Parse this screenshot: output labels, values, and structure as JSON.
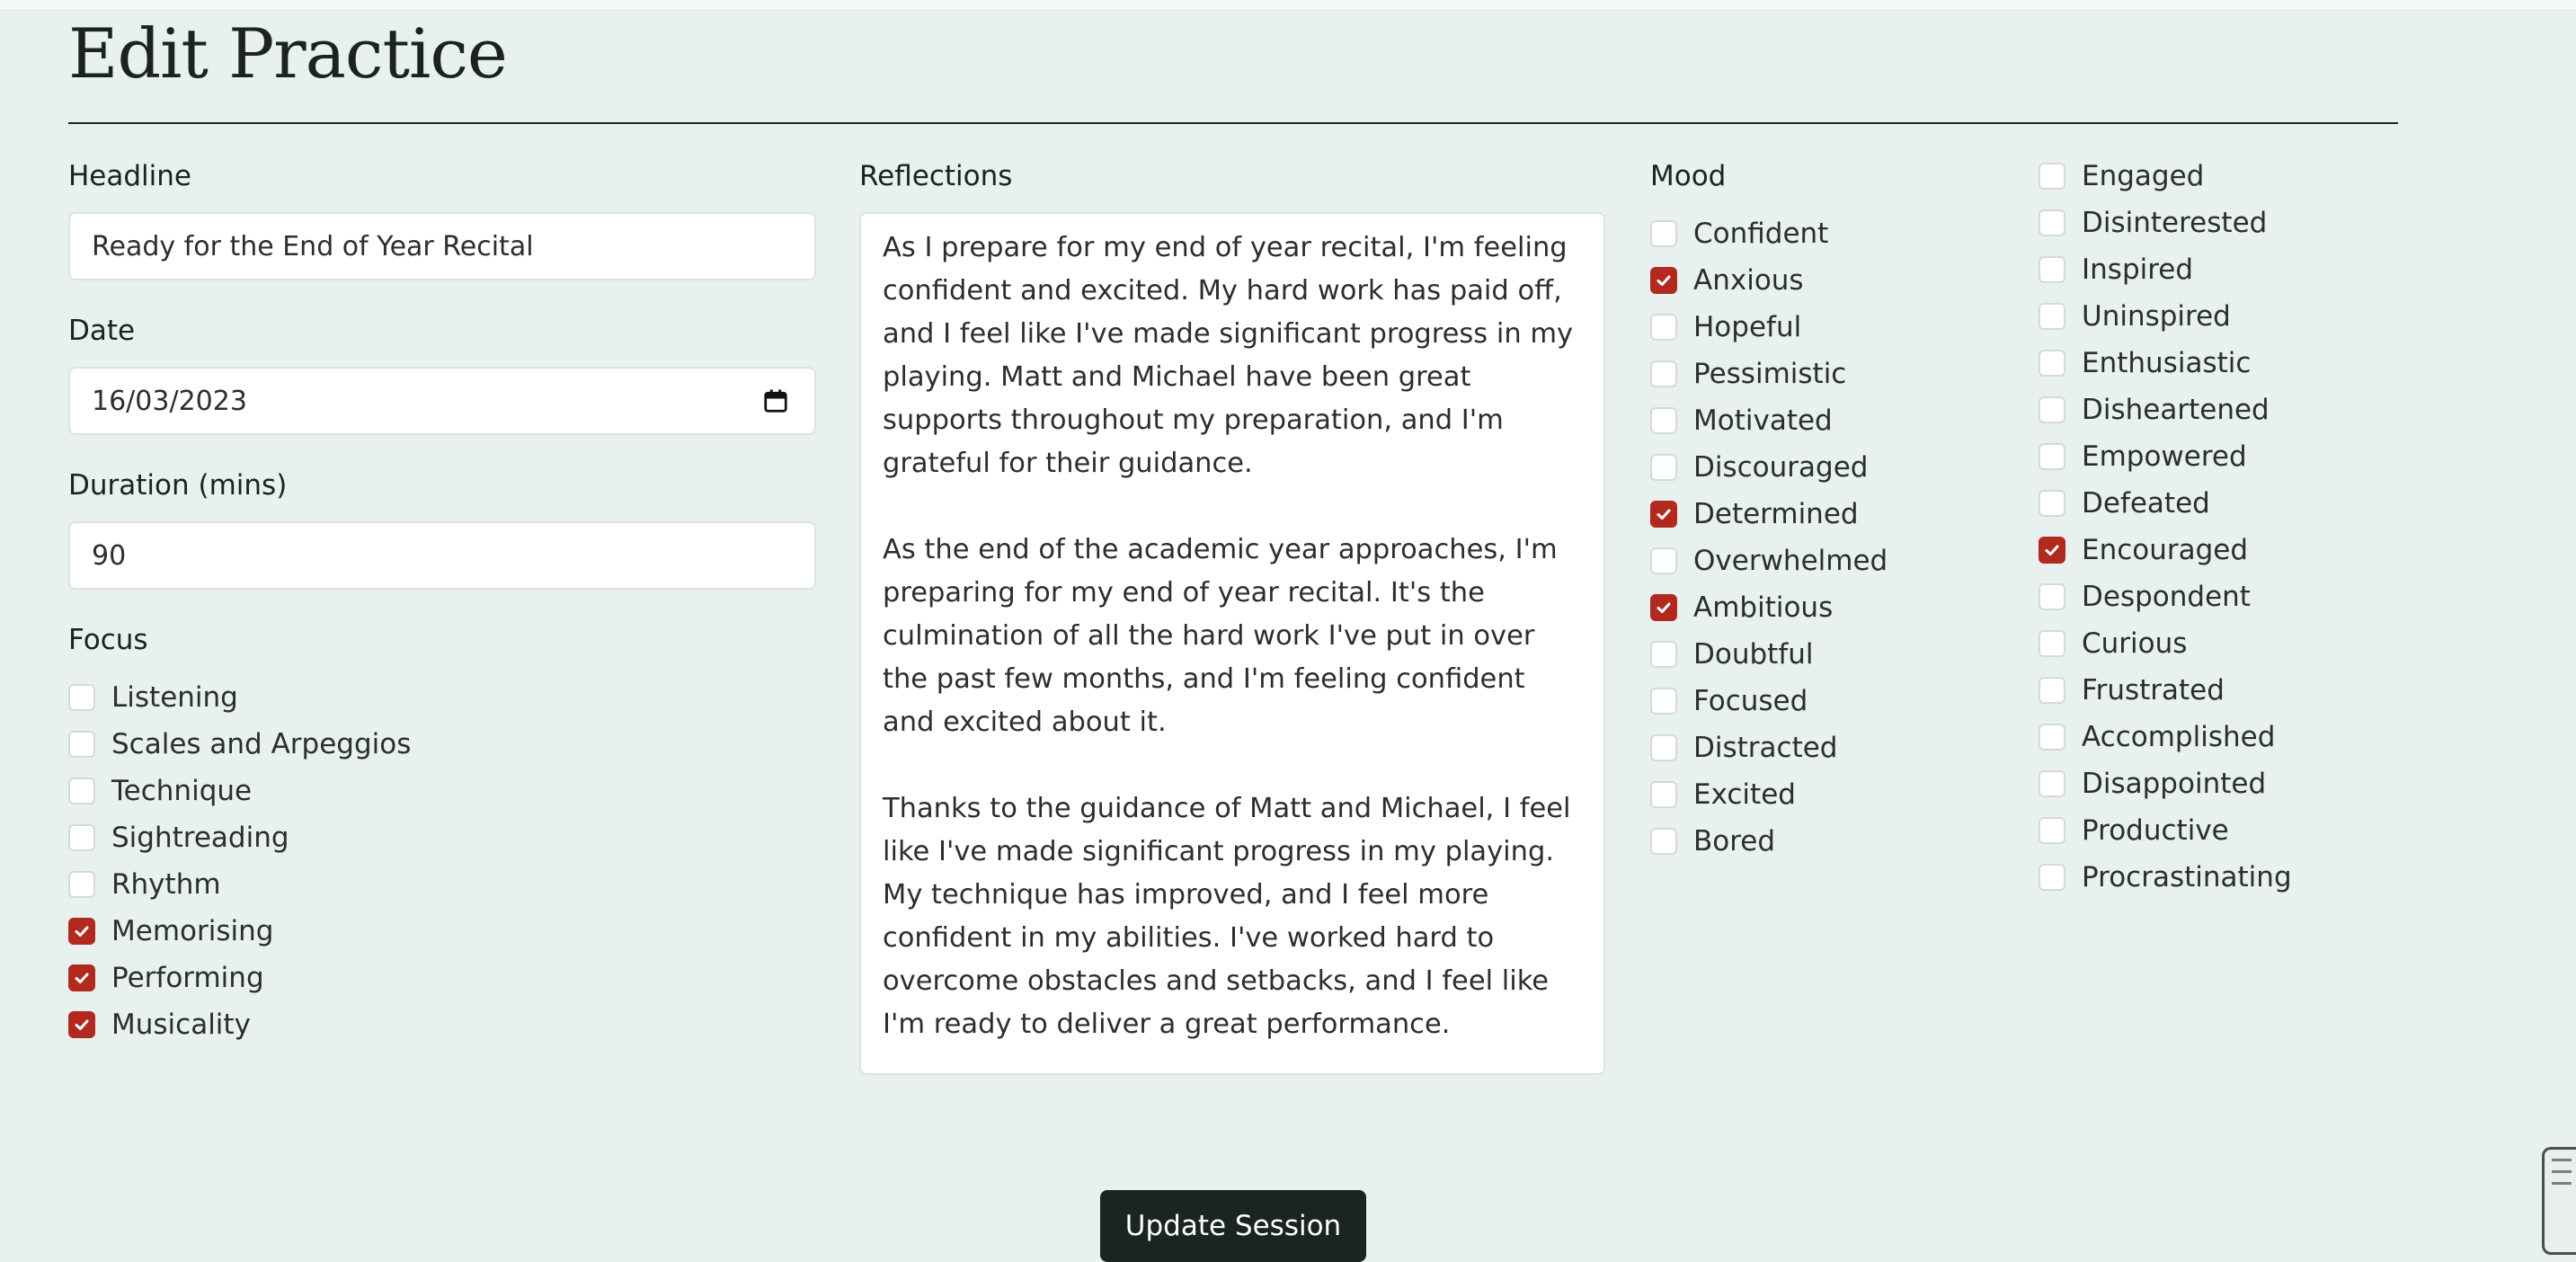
{
  "page": {
    "title": "Edit Practice"
  },
  "form": {
    "headline": {
      "label": "Headline",
      "value": "Ready for the End of Year Recital"
    },
    "date": {
      "label": "Date",
      "value": "16/03/2023"
    },
    "duration": {
      "label": "Duration (mins)",
      "value": "90"
    },
    "reflections": {
      "label": "Reflections",
      "value": "As I prepare for my end of year recital, I'm feeling confident and excited. My hard work has paid off, and I feel like I've made significant progress in my playing. Matt and Michael have been great supports throughout my preparation, and I'm grateful for their guidance.\n\nAs the end of the academic year approaches, I'm preparing for my end of year recital. It's the culmination of all the hard work I've put in over the past few months, and I'm feeling confident and excited about it.\n\nThanks to the guidance of Matt and Michael, I feel like I've made significant progress in my playing. My technique has improved, and I feel more confident in my abilities. I've worked hard to overcome obstacles and setbacks, and I feel like I'm ready to deliver a great performance."
    },
    "focus": {
      "label": "Focus",
      "options": [
        {
          "label": "Listening",
          "checked": false
        },
        {
          "label": "Scales and Arpeggios",
          "checked": false
        },
        {
          "label": "Technique",
          "checked": false
        },
        {
          "label": "Sightreading",
          "checked": false
        },
        {
          "label": "Rhythm",
          "checked": false
        },
        {
          "label": "Memorising",
          "checked": true
        },
        {
          "label": "Performing",
          "checked": true
        },
        {
          "label": "Musicality",
          "checked": true
        }
      ]
    },
    "mood": {
      "label": "Mood",
      "column1": [
        {
          "label": "Confident",
          "checked": false
        },
        {
          "label": "Anxious",
          "checked": true
        },
        {
          "label": "Hopeful",
          "checked": false
        },
        {
          "label": "Pessimistic",
          "checked": false
        },
        {
          "label": "Motivated",
          "checked": false
        },
        {
          "label": "Discouraged",
          "checked": false
        },
        {
          "label": "Determined",
          "checked": true
        },
        {
          "label": "Overwhelmed",
          "checked": false
        },
        {
          "label": "Ambitious",
          "checked": true
        },
        {
          "label": "Doubtful",
          "checked": false
        },
        {
          "label": "Focused",
          "checked": false
        },
        {
          "label": "Distracted",
          "checked": false
        },
        {
          "label": "Excited",
          "checked": false
        },
        {
          "label": "Bored",
          "checked": false
        }
      ],
      "column2": [
        {
          "label": "Engaged",
          "checked": false
        },
        {
          "label": "Disinterested",
          "checked": false
        },
        {
          "label": "Inspired",
          "checked": false
        },
        {
          "label": "Uninspired",
          "checked": false
        },
        {
          "label": "Enthusiastic",
          "checked": false
        },
        {
          "label": "Disheartened",
          "checked": false
        },
        {
          "label": "Empowered",
          "checked": false
        },
        {
          "label": "Defeated",
          "checked": false
        },
        {
          "label": "Encouraged",
          "checked": true
        },
        {
          "label": "Despondent",
          "checked": false
        },
        {
          "label": "Curious",
          "checked": false
        },
        {
          "label": "Frustrated",
          "checked": false
        },
        {
          "label": "Accomplished",
          "checked": false
        },
        {
          "label": "Disappointed",
          "checked": false
        },
        {
          "label": "Productive",
          "checked": false
        },
        {
          "label": "Procrastinating",
          "checked": false
        }
      ]
    },
    "submit_label": "Update Session"
  },
  "icons": {
    "date_picker": "calendar-icon",
    "checkbox_checked": "checkmark-icon"
  },
  "colors": {
    "background": "#e8f0f0",
    "accent": "#b22a1f",
    "button": "#1a2420"
  }
}
